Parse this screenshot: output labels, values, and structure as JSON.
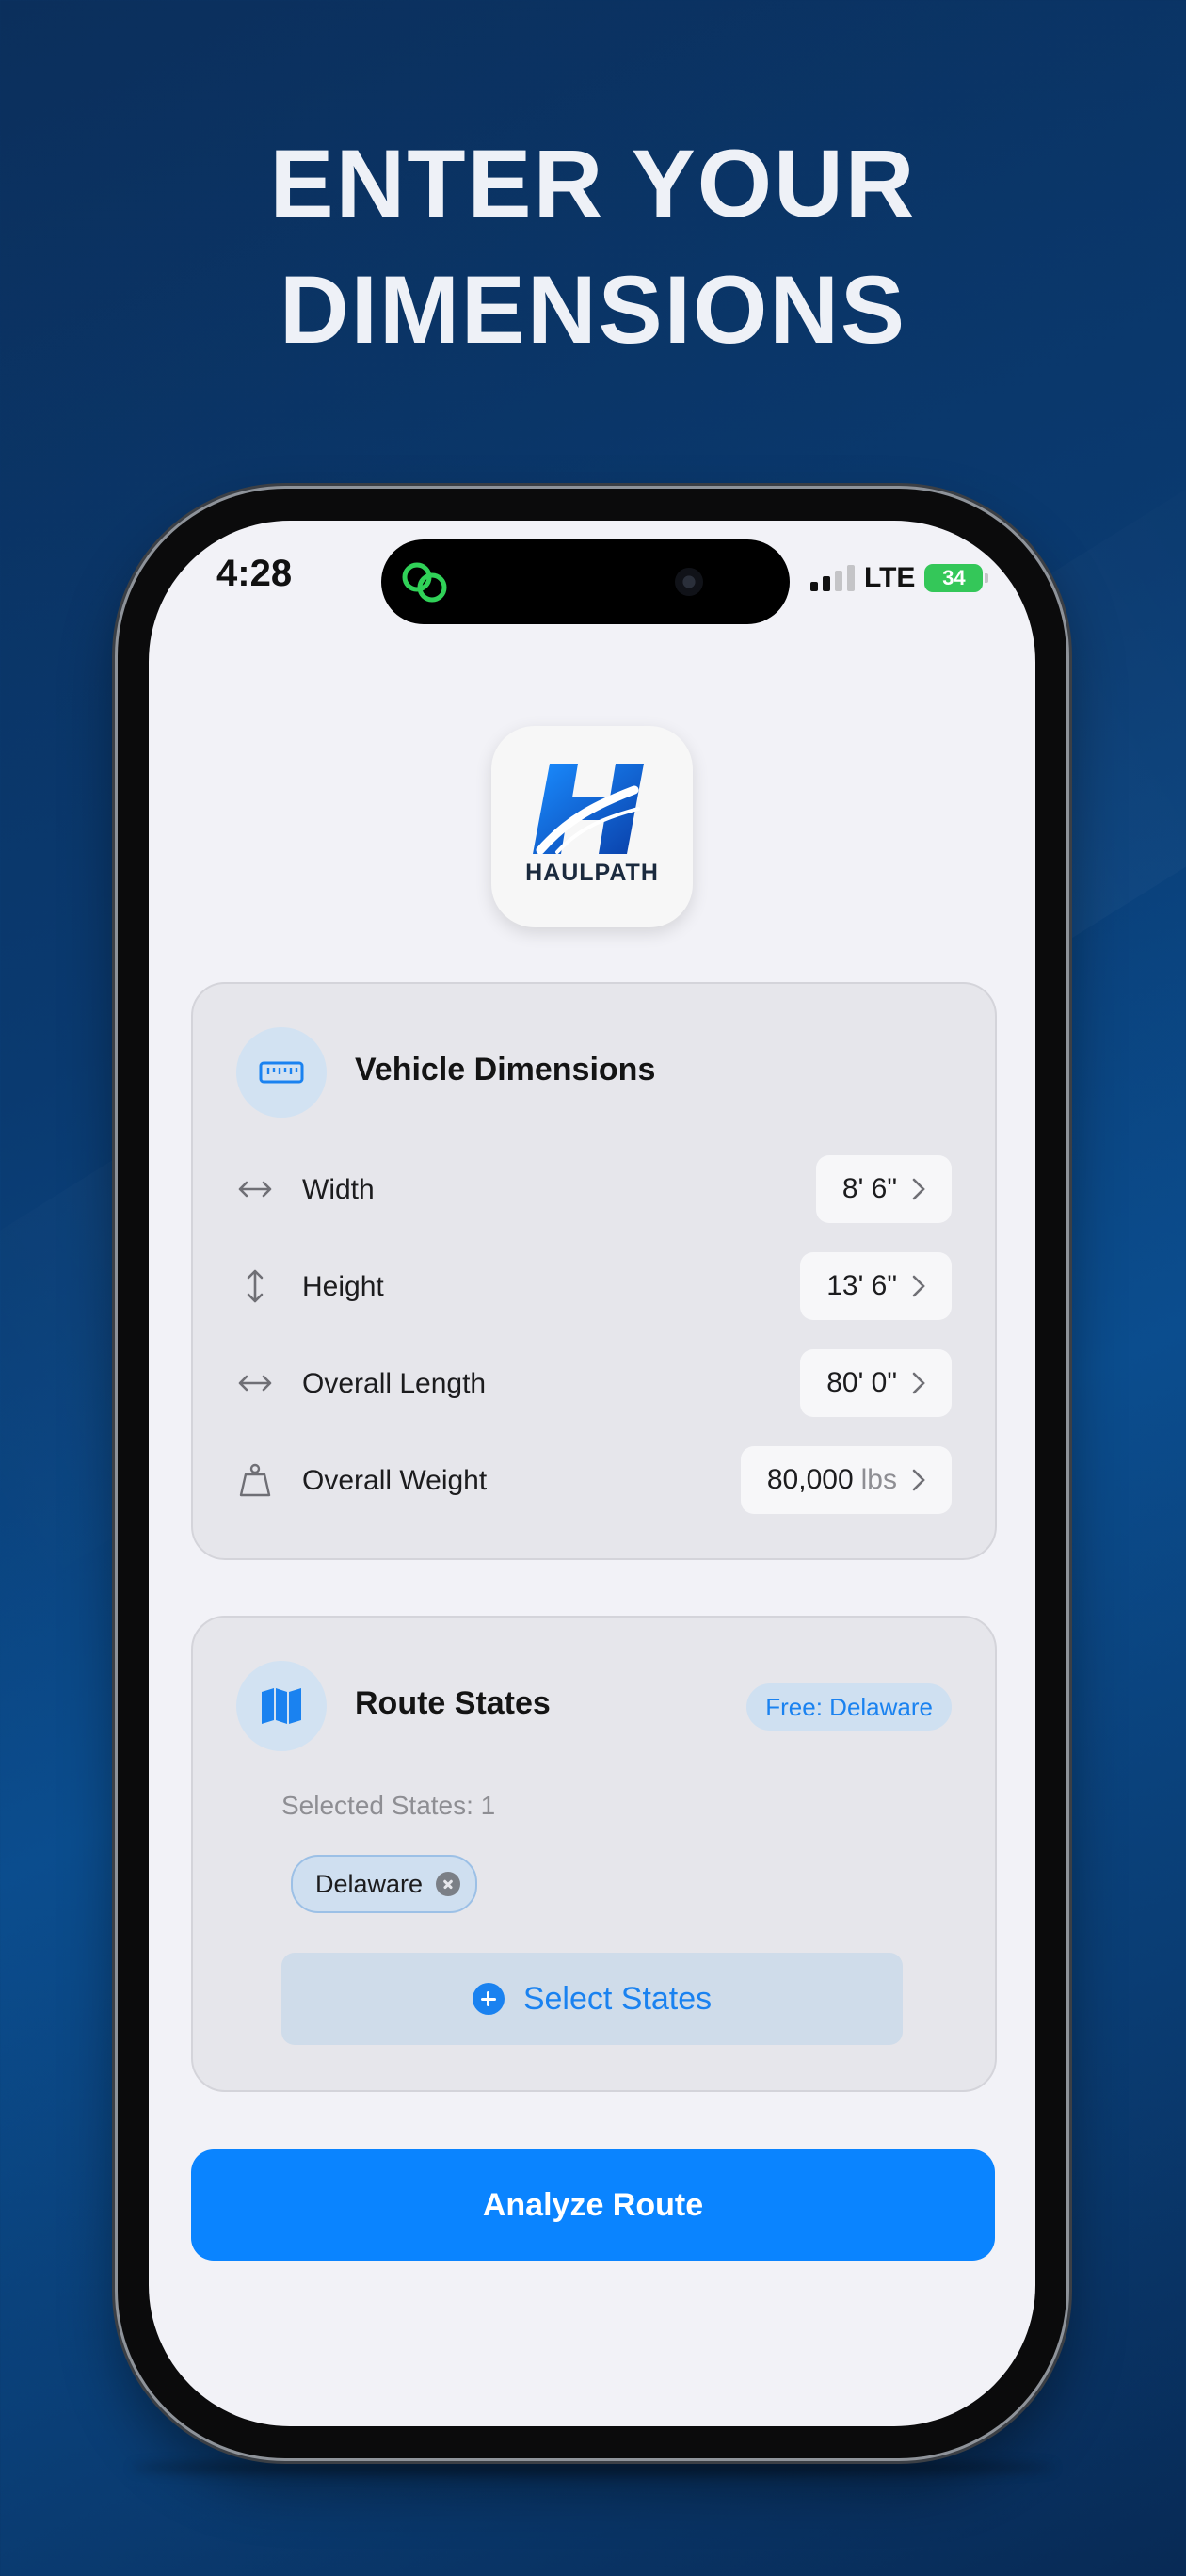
{
  "headline": {
    "line1": "ENTER YOUR",
    "line2": "DIMENSIONS"
  },
  "status_bar": {
    "time": "4:28",
    "network": "LTE",
    "battery": "34"
  },
  "app": {
    "name": "HAULPATH"
  },
  "vehicle": {
    "title": "Vehicle Dimensions",
    "rows": [
      {
        "label": "Width",
        "value": "8' 6\"",
        "unit": ""
      },
      {
        "label": "Height",
        "value": "13' 6\"",
        "unit": ""
      },
      {
        "label": "Overall Length",
        "value": "80' 0\"",
        "unit": ""
      },
      {
        "label": "Overall Weight",
        "value": "80,000",
        "unit": "lbs"
      }
    ]
  },
  "route": {
    "title": "Route States",
    "badge": "Free: Delaware",
    "selected_count": "Selected States: 1",
    "chips": [
      "Delaware"
    ],
    "select_button": "Select States"
  },
  "analyze_button": "Analyze Route",
  "colors": {
    "accent": "#0a84ff",
    "background": "#0b3d74",
    "screen": "#f2f2f7"
  }
}
